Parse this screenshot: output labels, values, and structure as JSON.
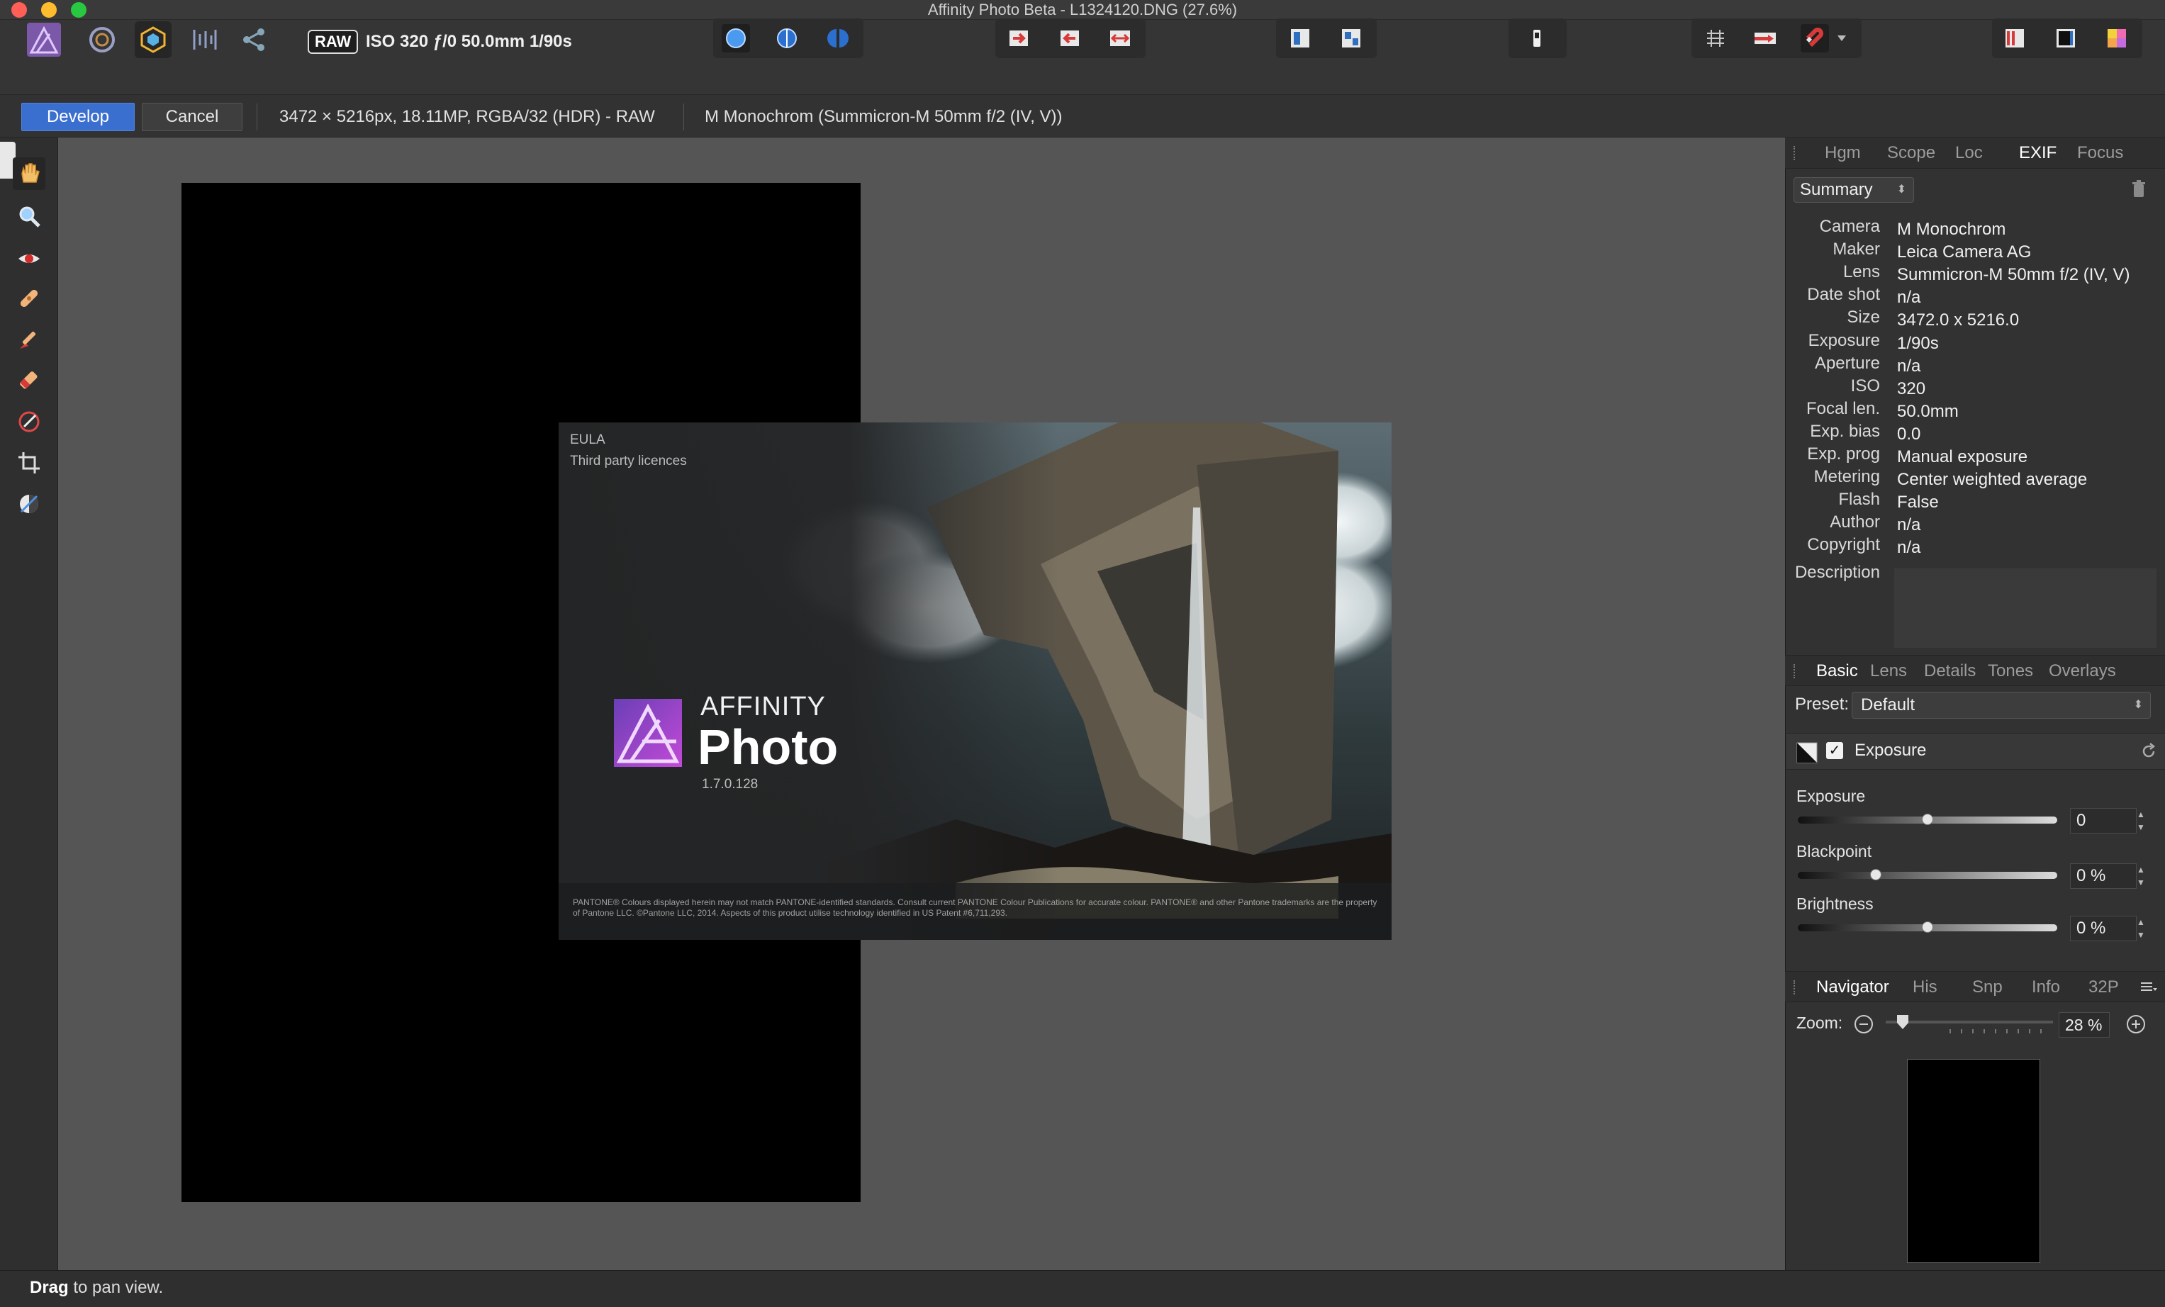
{
  "window": {
    "title": "Affinity Photo Beta - L1324120.DNG (27.6%)",
    "traffic_lights": {
      "close": "#ff5f57",
      "minimize": "#febc2e",
      "zoom": "#28c840"
    }
  },
  "toolbar": {
    "raw_badge": "RAW",
    "raw_info": "ISO 320 ƒ/0 50.0mm 1/90s",
    "personas": [
      "photo-persona-icon",
      "liquify-persona-icon",
      "develop-persona-icon",
      "tone-mapping-persona-icon",
      "export-persona-icon"
    ],
    "groups": [
      {
        "name": "view-mode",
        "icons": [
          "single-view-icon",
          "split-view-icon",
          "mirror-view-icon"
        ]
      },
      {
        "name": "rotate",
        "icons": [
          "rotate-right-icon",
          "rotate-left-icon",
          "flip-horizontal-icon"
        ]
      },
      {
        "name": "panels",
        "icons": [
          "show-basic-panel-icon",
          "show-panels-icon"
        ]
      },
      {
        "name": "clipping",
        "icons": [
          "clipping-warning-icon"
        ]
      },
      {
        "name": "overlays",
        "icons": [
          "grid-icon",
          "show-overlay-icon",
          "magnet-icon"
        ]
      },
      {
        "name": "assistant",
        "icons": [
          "clipped-highlights-icon",
          "clipped-shadows-icon",
          "clipped-tones-icon"
        ]
      }
    ]
  },
  "context": {
    "develop": "Develop",
    "cancel": "Cancel",
    "image_info": "3472 × 5216px, 18.11MP, RGBA/32 (HDR) - RAW",
    "lens_info": "M Monochrom (Summicron-M 50mm f/2 (IV, V))"
  },
  "tools": [
    "view-tool-icon",
    "zoom-tool-icon",
    "red-eye-tool-icon",
    "blemish-removal-tool-icon",
    "overlay-paint-tool-icon",
    "overlay-erase-tool-icon",
    "overlay-gradient-tool-icon",
    "crop-tool-icon",
    "white-balance-tool-icon"
  ],
  "splash": {
    "eula": "EULA",
    "licences": "Third party licences",
    "brand_line1": "AFFINITY",
    "brand_line2": "Photo",
    "version": "1.7.0.128",
    "legal": "PANTONE® Colours displayed herein may not match PANTONE-identified standards. Consult current PANTONE Colour Publications for accurate colour. PANTONE® and other Pantone trademarks are the property of Pantone LLC. ©Pantone LLC, 2014. Aspects of this product utilise technology identified in US Patent #6,711,293."
  },
  "exif_panel": {
    "tabs": [
      "Hgm",
      "Scope",
      "Loc",
      "EXIF",
      "Focus"
    ],
    "active_tab": "EXIF",
    "summary_select": "Summary",
    "fields": [
      {
        "key": "Camera",
        "value": "M Monochrom"
      },
      {
        "key": "Maker",
        "value": "Leica Camera AG"
      },
      {
        "key": "Lens",
        "value": "Summicron-M 50mm f/2 (IV, V)"
      },
      {
        "key": "Date shot",
        "value": "n/a"
      },
      {
        "key": "Size",
        "value": "3472.0 x 5216.0"
      },
      {
        "key": "Exposure",
        "value": "1/90s"
      },
      {
        "key": "Aperture",
        "value": "n/a"
      },
      {
        "key": "ISO",
        "value": "320"
      },
      {
        "key": "Focal len.",
        "value": "50.0mm"
      },
      {
        "key": "Exp. bias",
        "value": "0.0"
      },
      {
        "key": "Exp. prog",
        "value": "Manual exposure"
      },
      {
        "key": "Metering",
        "value": "Center weighted average"
      },
      {
        "key": "Flash",
        "value": "False"
      },
      {
        "key": "Author",
        "value": "n/a"
      },
      {
        "key": "Copyright",
        "value": "n/a"
      }
    ],
    "description_label": "Description"
  },
  "basic_panel": {
    "tabs": [
      "Basic",
      "Lens",
      "Details",
      "Tones",
      "Overlays"
    ],
    "active_tab": "Basic",
    "preset_label": "Preset:",
    "preset_value": "Default",
    "exposure_section": "Exposure",
    "exposure_enabled": true,
    "sliders": [
      {
        "label": "Exposure",
        "value": "0",
        "position": 0.5
      },
      {
        "label": "Blackpoint",
        "value": "0 %",
        "position": 0.3
      },
      {
        "label": "Brightness",
        "value": "0 %",
        "position": 0.5
      }
    ]
  },
  "navigator": {
    "tabs": [
      "Navigator",
      "His",
      "Snp",
      "Info",
      "32P"
    ],
    "active_tab": "Navigator",
    "zoom_label": "Zoom:",
    "zoom_value": "28 %",
    "zoom_position": 0.1
  },
  "status": {
    "bold": "Drag",
    "rest": " to pan view."
  }
}
